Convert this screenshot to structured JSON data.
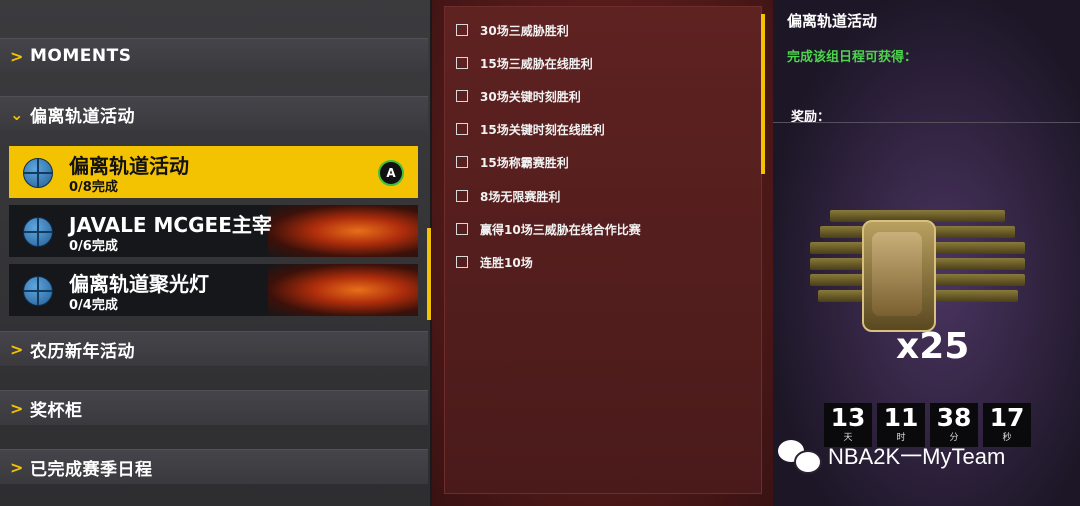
{
  "sidebar": {
    "categories": [
      {
        "label": "MOMENTS"
      },
      {
        "label": "偏离轨道活动"
      },
      {
        "label": "农历新年活动"
      },
      {
        "label": "奖杯柜"
      },
      {
        "label": "已完成赛季日程"
      }
    ],
    "items": [
      {
        "title": "偏离轨道活动",
        "progress": "0/8完成",
        "button": "A"
      },
      {
        "title": "JAVALE MCGEE主宰",
        "progress": "0/6完成"
      },
      {
        "title": "偏离轨道聚光灯",
        "progress": "0/4完成"
      }
    ]
  },
  "goals": [
    "30场三威胁胜利",
    "15场三威胁在线胜利",
    "30场关键时刻胜利",
    "15场关键时刻在线胜利",
    "15场称霸赛胜利",
    "8场无限赛胜利",
    "赢得10场三威胁在线合作比赛",
    "连胜10场"
  ],
  "reward_panel": {
    "title": "偏离轨道活动",
    "subtitle": "完成该组日程可获得：",
    "reward_label": "奖励：",
    "multiplier": "x25",
    "timer": [
      {
        "value": "13",
        "unit": "天"
      },
      {
        "value": "11",
        "unit": "时"
      },
      {
        "value": "38",
        "unit": "分"
      },
      {
        "value": "17",
        "unit": "秒"
      }
    ]
  },
  "watermark": "NBA2K一MyTeam",
  "colors": {
    "accent": "#f3c200",
    "green": "#4dd34d"
  }
}
